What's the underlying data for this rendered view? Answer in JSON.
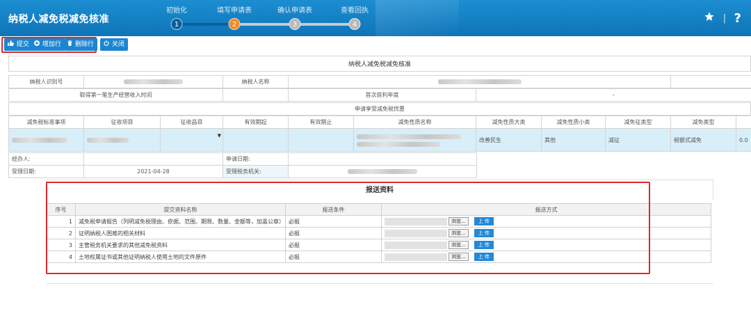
{
  "header": {
    "title": "纳税人减免税减免核准",
    "steps": [
      {
        "label": "初始化",
        "number": "1",
        "state": "done"
      },
      {
        "label": "填写申请表",
        "number": "2",
        "state": "active"
      },
      {
        "label": "确认申请表",
        "number": "3",
        "state": "todo"
      },
      {
        "label": "查看回执",
        "number": "4",
        "state": "todo"
      }
    ],
    "icons": {
      "favorite": "star-icon",
      "help": "question-icon"
    },
    "help_glyph": "?",
    "separator": "|"
  },
  "toolbar": {
    "submit_label": "提交",
    "add_row_label": "增加行",
    "delete_row_label": "删除行",
    "close_label": "关闭"
  },
  "form": {
    "title": "纳税人减免税减免核准",
    "taxpayer_id_label": "纳税人识别号",
    "taxpayer_name_label": "纳税人名称",
    "first_income_time_label": "取得第一笔生产经营收入时间",
    "first_profit_year_label": "首次获利年度",
    "dash": "-",
    "apply_section_label": "申请享受减免税优惠",
    "columns": [
      "减免税标准事项",
      "征收项目",
      "征收品目",
      "有效期起",
      "有效期止",
      "减免性质名称",
      "减免性质大类",
      "减免性质小类",
      "减免征类型",
      "减免类型"
    ],
    "row": {
      "major_category": "改善民生",
      "minor_category": "其他",
      "reduction_type": "减征",
      "exemption_type": "税额式减免",
      "amount": "0.0"
    },
    "handler_label": "经办人:",
    "apply_date_label": "申请日期:",
    "accept_date_label": "受理日期:",
    "accept_date_value": "2021-04-28",
    "accept_office_label": "受理税务机关:"
  },
  "submission": {
    "title": "报送资料",
    "columns": [
      "序号",
      "提交资料名称",
      "报送条件",
      "报送方式"
    ],
    "browse_label": "浏览...",
    "upload_label": "上 传",
    "rows": [
      {
        "no": "1",
        "name": "减免税申请报告（列明减免税理由、依据、范围、期限、数量、金额等，加盖公章）",
        "condition": "必报"
      },
      {
        "no": "2",
        "name": "证明纳税人困难的相关材料",
        "condition": "必报"
      },
      {
        "no": "3",
        "name": "主管税务机关要求的其他减免税资料",
        "condition": "必报"
      },
      {
        "no": "4",
        "name": "土地权属证书或其他证明纳税人使用土地的文件原件",
        "condition": "必报"
      }
    ]
  },
  "colors": {
    "header": "#1383c8",
    "step_done": "#0a5f9b",
    "step_active": "#f08b24",
    "button": "#1b86cf",
    "highlight": "#e0262b",
    "selected_row": "#d8eef9"
  }
}
